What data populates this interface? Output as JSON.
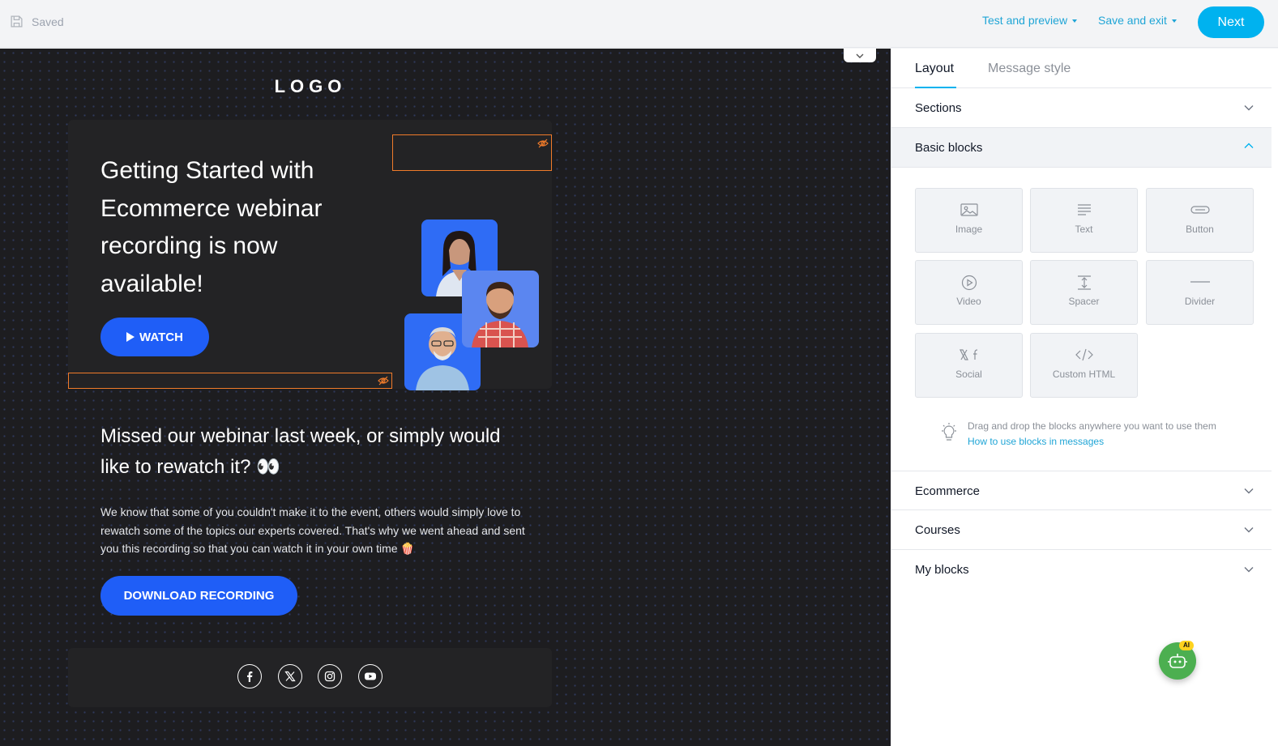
{
  "topbar": {
    "saved_label": "Saved",
    "test_preview_label": "Test and preview",
    "save_exit_label": "Save and exit",
    "next_label": "Next",
    "accent_color": "#00b2ef"
  },
  "email": {
    "logo_text": "LOGO",
    "hero_title": "Getting Started with Ecommerce webinar recording is now available!",
    "watch_label": "WATCH",
    "intro_title": "Missed our webinar last week, or simply would like to rewatch it? 👀",
    "intro_body": "We know that some of you couldn't make it to the event, others would simply love to rewatch some of the topics our experts covered. That's why we went ahead and sent you this recording so that you can watch it in your own time 🍿",
    "download_label": "DOWNLOAD RECORDING",
    "button_color": "#1f5ef7",
    "social_icons": [
      "facebook-icon",
      "x-icon",
      "instagram-icon",
      "youtube-icon"
    ]
  },
  "panel": {
    "tabs": [
      {
        "label": "Layout",
        "active": true
      },
      {
        "label": "Message style",
        "active": false
      }
    ],
    "sections_label": "Sections",
    "basic_blocks_label": "Basic blocks",
    "blocks": [
      {
        "label": "Image",
        "icon": "image-icon"
      },
      {
        "label": "Text",
        "icon": "text-icon"
      },
      {
        "label": "Button",
        "icon": "button-icon"
      },
      {
        "label": "Video",
        "icon": "video-icon"
      },
      {
        "label": "Spacer",
        "icon": "spacer-icon"
      },
      {
        "label": "Divider",
        "icon": "divider-icon"
      },
      {
        "label": "Social",
        "icon": "social-icon"
      },
      {
        "label": "Custom HTML",
        "icon": "code-icon"
      }
    ],
    "hint_text": "Drag and drop the blocks anywhere you want to use them",
    "hint_link": "How to use blocks in messages",
    "ecommerce_label": "Ecommerce",
    "courses_label": "Courses",
    "my_blocks_label": "My blocks",
    "ai_badge": "AI"
  }
}
